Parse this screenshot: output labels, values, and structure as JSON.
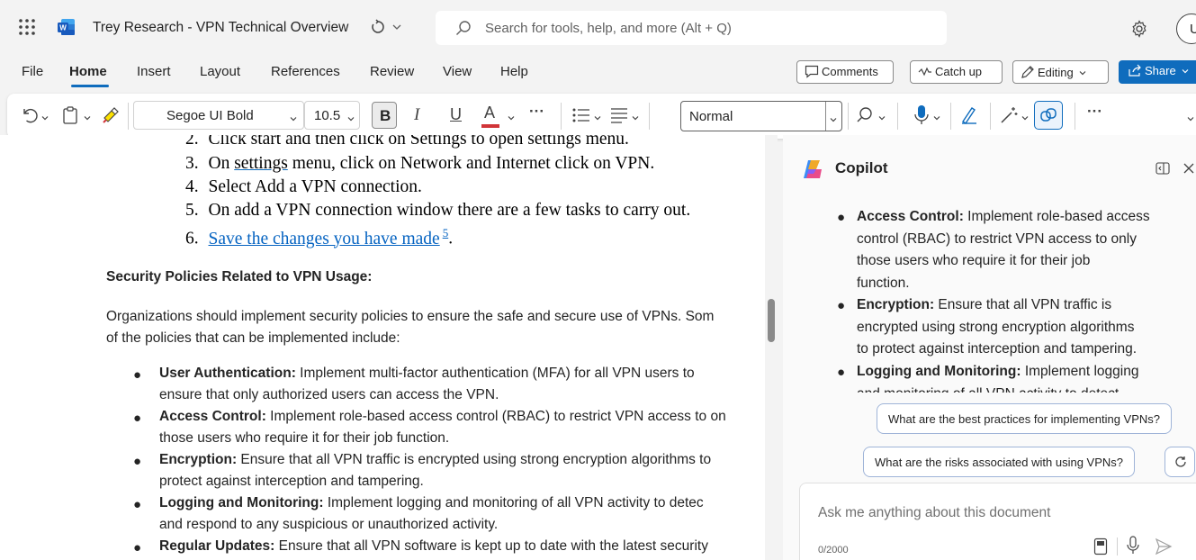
{
  "titlebar": {
    "doc_title": "Trey Research - VPN Technical Overview",
    "search_placeholder": "Search for tools, help, and more (Alt + Q)",
    "avatar_initial": "U"
  },
  "tabs": [
    "File",
    "Home",
    "Insert",
    "Layout",
    "References",
    "Review",
    "View",
    "Help"
  ],
  "actions": {
    "comments": "Comments",
    "catchup": "Catch up",
    "editing": "Editing",
    "share": "Share"
  },
  "ribbon": {
    "font_name": "Segoe UI Bold",
    "font_size": "10.5",
    "bold": "B",
    "italic": "I",
    "underline": "U",
    "font_color": "A",
    "style": "Normal",
    "more": "···"
  },
  "document": {
    "ol_items": [
      {
        "num": "2.",
        "text": "Click start and then click on Settings to open settings menu."
      },
      {
        "num": "3.",
        "pre": "On ",
        "link": "settings",
        "text": " menu, click on Network and Internet click on VPN."
      },
      {
        "num": "4.",
        "text": "Select Add a VPN connection."
      },
      {
        "num": "5.",
        "text": "On add a VPN connection window there are a few tasks to carry out."
      },
      {
        "num": "6.",
        "link_text": "Save the changes you have made",
        "sup": "5",
        "suffix": "."
      }
    ],
    "heading": "Security Policies Related to VPN Usage:",
    "para1": "Organizations should implement security policies to ensure the safe and secure use of VPNs. Som",
    "para2": "of the policies that can be implemented include:",
    "bullets": [
      {
        "term": "User Authentication:",
        "line1": " Implement multi-factor authentication (MFA) for all VPN users to",
        "line2": "ensure that only authorized users can access the VPN."
      },
      {
        "term": "Access Control:",
        "line1": " Implement role-based access control (RBAC) to restrict VPN access to on",
        "line2": "those users who require it for their job function."
      },
      {
        "term": "Encryption:",
        "line1": " Ensure that all VPN traffic is encrypted using strong encryption algorithms to",
        "line2": "protect against interception and tampering."
      },
      {
        "term": "Logging and Monitoring:",
        "line1": " Implement logging and monitoring of all VPN activity to detec",
        "line2": "and respond to any suspicious or unauthorized activity."
      },
      {
        "term": "Regular Updates:",
        "line1": " Ensure that all VPN software is kept up to date with the latest security",
        "line2": ""
      }
    ]
  },
  "copilot": {
    "title": "Copilot",
    "bullets": [
      {
        "term": "Access Control:",
        "lines": [
          " Implement role-based access",
          "control (RBAC) to restrict VPN access to only",
          "those users who require it for their job",
          "function."
        ]
      },
      {
        "term": "Encryption:",
        "lines": [
          " Ensure that all VPN traffic is",
          "encrypted using strong encryption algorithms",
          "to protect against interception and tampering."
        ]
      },
      {
        "term": "Logging and Monitoring:",
        "lines": [
          " Implement logging",
          "and monitoring of all VPN activity to detect"
        ]
      }
    ],
    "suggestion1": "What are the best practices for implementing VPNs?",
    "suggestion2": "What are the risks associated with using VPNs?",
    "input_placeholder": "Ask me anything about this document",
    "char_count": "0/2000"
  },
  "colors": {
    "accent": "#0f6cbd",
    "link": "#0563c1",
    "word_blue": "#185abd",
    "red": "#d13438"
  }
}
